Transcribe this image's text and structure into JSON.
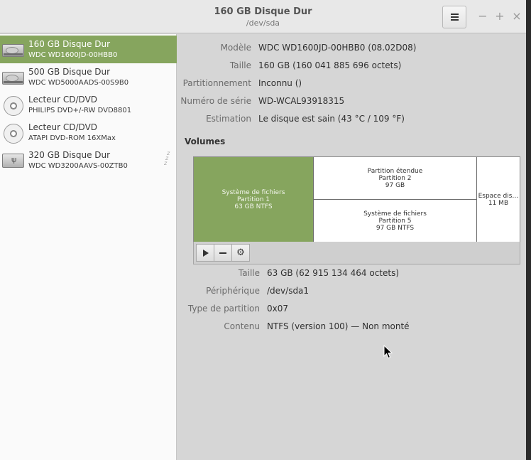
{
  "window": {
    "title": "160 GB Disque Dur",
    "subtitle": "/dev/sda",
    "controls": {
      "minimize": "−",
      "maximize": "+",
      "close": "×"
    }
  },
  "sidebar": {
    "drives": [
      {
        "name": "160 GB Disque Dur",
        "model": "WDC WD1600JD-00HBB0",
        "icon": "hard-disk-icon",
        "selected": true
      },
      {
        "name": "500 GB Disque Dur",
        "model": "WDC WD5000AADS-00S9B0",
        "icon": "hard-disk-icon",
        "selected": false
      },
      {
        "name": "Lecteur CD/DVD",
        "model": "PHILIPS DVD+/-RW DVD8801",
        "icon": "optical-disc-icon",
        "selected": false
      },
      {
        "name": "Lecteur CD/DVD",
        "model": "ATAPI DVD-ROM 16XMax",
        "icon": "optical-disc-icon",
        "selected": false
      },
      {
        "name": "320 GB Disque Dur",
        "model": "WDC WD3200AAVS-00ZTB0",
        "icon": "usb-drive-icon",
        "selected": false,
        "sleeping_glyph": "z z z"
      }
    ]
  },
  "drive_info": {
    "model_label": "Modèle",
    "model_value": "WDC WD1600JD-00HBB0 (08.02D08)",
    "size_label": "Taille",
    "size_value": "160 GB (160 041 885 696 octets)",
    "partitioning_label": "Partitionnement",
    "partitioning_value": "Inconnu ()",
    "serial_label": "Numéro de série",
    "serial_value": "WD-WCAL93918315",
    "assessment_label": "Estimation",
    "assessment_value": "Le disque est sain (43 °C / 109 °F)"
  },
  "volumes": {
    "heading": "Volumes",
    "partition1": {
      "line1": "Système de fichiers",
      "line2": "Partition 1",
      "line3": "63 GB NTFS"
    },
    "extended": {
      "line1": "Partition étendue",
      "line2": "Partition 2",
      "line3": "97 GB"
    },
    "partition5": {
      "line1": "Système de fichiers",
      "line2": "Partition 5",
      "line3": "97 GB NTFS"
    },
    "free": {
      "line1": "Espace dis…",
      "line2": "11 MB"
    }
  },
  "volume_info": {
    "size_label": "Taille",
    "size_value": "63 GB (62 915 134 464 octets)",
    "device_label": "Périphérique",
    "device_value": "/dev/sda1",
    "type_label": "Type de partition",
    "type_value": "0x07",
    "content_label": "Contenu",
    "content_value": "NTFS (version 100) — Non monté"
  },
  "colors": {
    "accent": "#86a55e",
    "header_bg": "#e8e8e8",
    "content_bg": "#d6d6d6",
    "sidebar_bg": "#fafafa"
  }
}
